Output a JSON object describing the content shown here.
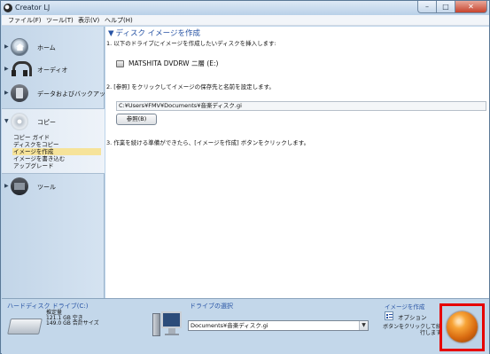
{
  "window": {
    "title": "Creator LJ",
    "controls": {
      "minimize": "–",
      "maximize": "□",
      "close": "✕"
    }
  },
  "menubar": {
    "items": [
      {
        "label": "ファイル(F)"
      },
      {
        "label": "ツール(T)"
      },
      {
        "label": "表示(V)"
      },
      {
        "label": "ヘルプ(H)"
      }
    ]
  },
  "sidebar": {
    "categories": [
      {
        "label": "ホーム",
        "icon": "home-icon"
      },
      {
        "label": "オーディオ",
        "icon": "headphones-icon"
      },
      {
        "label": "データおよびバックアップ",
        "icon": "backup-icon"
      },
      {
        "label": "コピー",
        "icon": "disc-copy-icon"
      },
      {
        "label": "ツール",
        "icon": "tools-icon"
      }
    ],
    "copy_items": [
      {
        "label": "コピー ガイド"
      },
      {
        "label": "ディスクをコピー"
      },
      {
        "label": "イメージを作成",
        "selected": true
      },
      {
        "label": "イメージを書き込む"
      },
      {
        "label": "アップグレード"
      }
    ]
  },
  "main": {
    "title": "ディスク イメージを作成",
    "step1": "1. 以下のドライブにイメージを作成したいディスクを挿入します:",
    "drive": "MATSHITA DVDRW 二層 (E:)",
    "step2": "2. [参照] をクリックしてイメージの保存先と名前を設定します。",
    "path": "C:¥Users¥FMV¥Documents¥音楽ディスク.gi",
    "browse_label": "参照(B)",
    "step3": "3. 作業を続ける準備ができたら、[イメージを作成] ボタンをクリックします。"
  },
  "bottom": {
    "hdd_title": "ハードディスク ドライブ(C:)",
    "hdd_stats": [
      "推定量",
      "121.1 GB 空き",
      "149.0 GB 合計サイズ"
    ],
    "drive_select_title": "ドライブの選択",
    "drive_select_value": "Documents¥音楽ディスク.gi",
    "create_title": "イメージを作成",
    "option_label": "オプション",
    "hint": "ボタンをクリックして続行します"
  },
  "colors": {
    "accent_text": "#2753a4",
    "highlight": "#e60000",
    "selected_item": "#f6e39a"
  }
}
